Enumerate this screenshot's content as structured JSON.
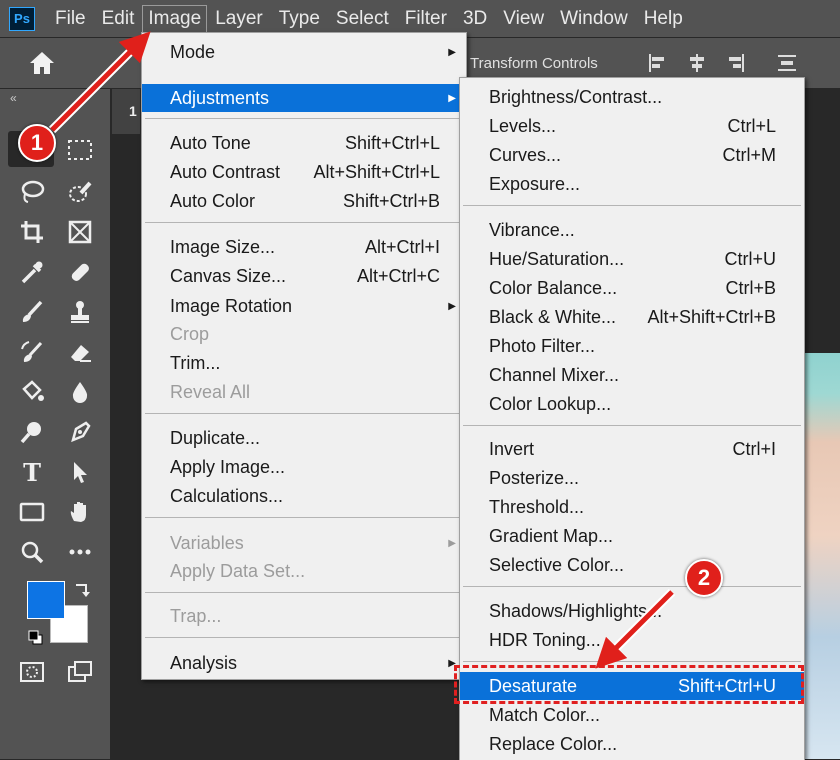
{
  "app": {
    "logo": "Ps"
  },
  "menubar": {
    "items": [
      "File",
      "Edit",
      "Image",
      "Layer",
      "Type",
      "Select",
      "Filter",
      "3D",
      "View",
      "Window",
      "Help"
    ],
    "active": "Image"
  },
  "options_bar": {
    "transform_controls": "Transform Controls"
  },
  "toolbar": {
    "collapse": "«"
  },
  "document": {
    "tab_label": "1"
  },
  "image_menu": {
    "mode": "Mode",
    "adjustments": "Adjustments",
    "auto_tone": {
      "label": "Auto Tone",
      "shortcut": "Shift+Ctrl+L"
    },
    "auto_contrast": {
      "label": "Auto Contrast",
      "shortcut": "Alt+Shift+Ctrl+L"
    },
    "auto_color": {
      "label": "Auto Color",
      "shortcut": "Shift+Ctrl+B"
    },
    "image_size": {
      "label": "Image Size...",
      "shortcut": "Alt+Ctrl+I"
    },
    "canvas_size": {
      "label": "Canvas Size...",
      "shortcut": "Alt+Ctrl+C"
    },
    "image_rotation": "Image Rotation",
    "crop": "Crop",
    "trim": "Trim...",
    "reveal_all": "Reveal All",
    "duplicate": "Duplicate...",
    "apply_image": "Apply Image...",
    "calculations": "Calculations...",
    "variables": "Variables",
    "apply_data_set": "Apply Data Set...",
    "trap": "Trap...",
    "analysis": "Analysis"
  },
  "adjustments_menu": {
    "brightness_contrast": {
      "label": "Brightness/Contrast...",
      "shortcut": ""
    },
    "levels": {
      "label": "Levels...",
      "shortcut": "Ctrl+L"
    },
    "curves": {
      "label": "Curves...",
      "shortcut": "Ctrl+M"
    },
    "exposure": {
      "label": "Exposure...",
      "shortcut": ""
    },
    "vibrance": {
      "label": "Vibrance...",
      "shortcut": ""
    },
    "hue_saturation": {
      "label": "Hue/Saturation...",
      "shortcut": "Ctrl+U"
    },
    "color_balance": {
      "label": "Color Balance...",
      "shortcut": "Ctrl+B"
    },
    "black_white": {
      "label": "Black & White...",
      "shortcut": "Alt+Shift+Ctrl+B"
    },
    "photo_filter": {
      "label": "Photo Filter...",
      "shortcut": ""
    },
    "channel_mixer": {
      "label": "Channel Mixer...",
      "shortcut": ""
    },
    "color_lookup": {
      "label": "Color Lookup...",
      "shortcut": ""
    },
    "invert": {
      "label": "Invert",
      "shortcut": "Ctrl+I"
    },
    "posterize": {
      "label": "Posterize...",
      "shortcut": ""
    },
    "threshold": {
      "label": "Threshold...",
      "shortcut": ""
    },
    "gradient_map": {
      "label": "Gradient Map...",
      "shortcut": ""
    },
    "selective_color": {
      "label": "Selective Color...",
      "shortcut": ""
    },
    "shadows_highlights": {
      "label": "Shadows/Highlights...",
      "shortcut": ""
    },
    "hdr_toning": {
      "label": "HDR Toning...",
      "shortcut": ""
    },
    "desaturate": {
      "label": "Desaturate",
      "shortcut": "Shift+Ctrl+U"
    },
    "match_color": {
      "label": "Match Color...",
      "shortcut": ""
    },
    "replace_color": {
      "label": "Replace Color...",
      "shortcut": ""
    }
  },
  "annotations": {
    "step1": "1",
    "step2": "2"
  },
  "colors": {
    "highlight": "#0a71d9",
    "annotation_red": "#e0201b",
    "foreground_color": "#0d74e4",
    "background_color": "#ffffff"
  }
}
